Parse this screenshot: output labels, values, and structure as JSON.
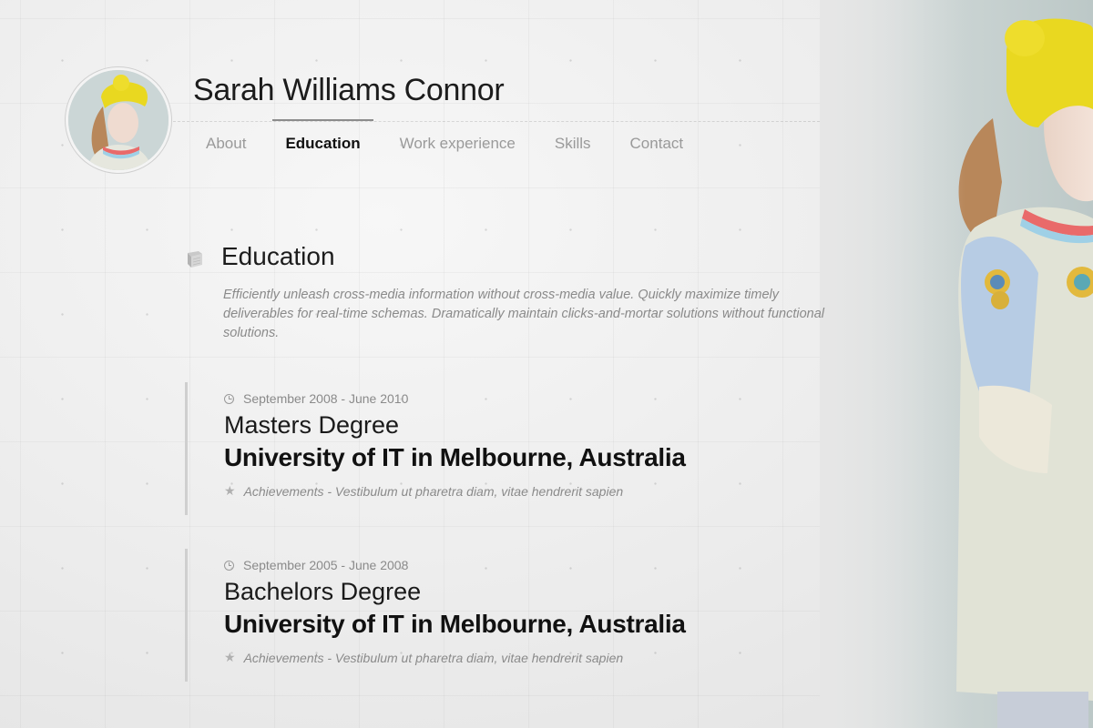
{
  "profile": {
    "name": "Sarah Williams Connor"
  },
  "nav": {
    "items": [
      {
        "label": "About"
      },
      {
        "label": "Education"
      },
      {
        "label": "Work experience"
      },
      {
        "label": "Skills"
      },
      {
        "label": "Contact"
      }
    ],
    "active": "Education"
  },
  "section": {
    "title": "Education",
    "icon": "book-icon",
    "description": "Efficiently unleash cross-media information without cross-media value. Quickly maximize timely deliverables for real-time schemas. Dramatically maintain clicks-and-mortar solutions without functional solutions."
  },
  "entries": [
    {
      "date": "September 2008 - June 2010",
      "degree": "Masters Degree",
      "school": "University of IT in Melbourne, Australia",
      "achievements": "Achievements - Vestibulum ut pharetra diam, vitae hendrerit sapien"
    },
    {
      "date": "September 2005 - June 2008",
      "degree": "Bachelors Degree",
      "school": "University of IT in Melbourne, Australia",
      "achievements": "Achievements - Vestibulum ut pharetra diam, vitae hendrerit sapien"
    }
  ],
  "colors": {
    "background": "#ececec",
    "text_primary": "#111111",
    "text_muted": "#8a8a8a",
    "accent_hat": "#e9d820"
  }
}
